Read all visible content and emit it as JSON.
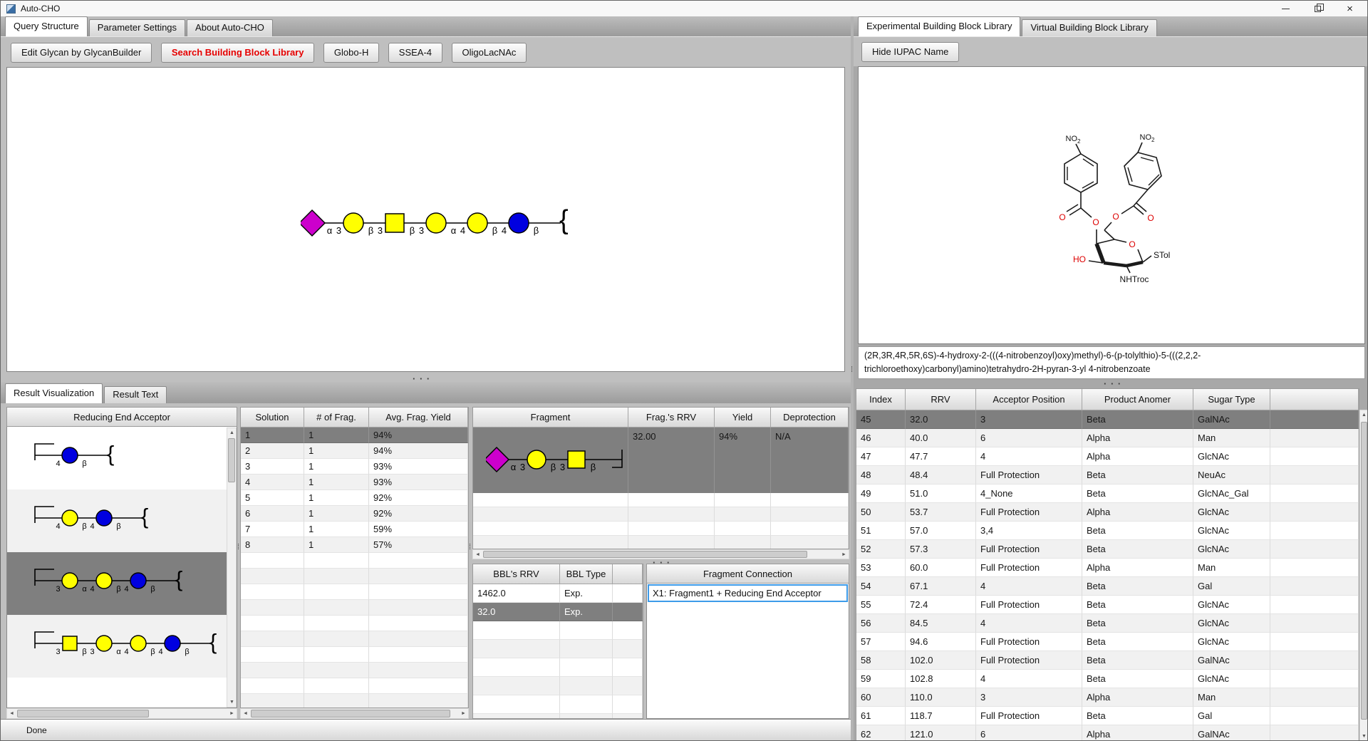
{
  "window": {
    "title": "Auto-CHO",
    "status": "Done"
  },
  "icons": {
    "up_arrow": "▲",
    "down_arrow": "▼",
    "left_arrow": "◄",
    "right_arrow": "►",
    "h_grip": "· · ·",
    "v_grip": "⁞",
    "close": "×"
  },
  "left_tabs": {
    "items": [
      "Query Structure",
      "Parameter Settings",
      "About Auto-CHO"
    ],
    "active": 0
  },
  "toolbar": {
    "buttons": [
      "Edit Glycan by GlycanBuilder",
      "Search Building Block Library",
      "Globo-H",
      "SSEA-4",
      "OligoLacNAc"
    ],
    "highlight_index": 1,
    "highlight_color": "#e60000"
  },
  "right_tabs": {
    "items": [
      "Experimental Building Block Library",
      "Virtual Building Block Library"
    ],
    "active": 0
  },
  "hide_iupac_button": "Hide IUPAC Name",
  "iupac_name": "(2R,3R,4R,5R,6S)-4-hydroxy-2-(((4-nitrobenzoyl)oxy)methyl)-6-(p-tolylthio)-5-(((2,2,2-trichloroethoxy)carbonyl)amino)tetrahydro-2H-pyran-3-yl 4-nitrobenzoate",
  "chem": {
    "no2": "NO",
    "no2_sub": "2",
    "o": "O",
    "ho": "HO",
    "stol": "STol",
    "nhtroc": "NHTroc"
  },
  "bottom_tabs": {
    "items": [
      "Result Visualization",
      "Result Text"
    ],
    "active": 0
  },
  "rea": {
    "header": "Reducing End Acceptor",
    "selected_index": 2,
    "items": [
      {
        "glycan": "rea1"
      },
      {
        "glycan": "rea2"
      },
      {
        "glycan": "rea3"
      },
      {
        "glycan": "rea4"
      },
      {
        "partial": true
      }
    ]
  },
  "solutions": {
    "headers": [
      "Solution",
      "# of Frag.",
      "Avg. Frag. Yield"
    ],
    "rows": [
      [
        "1",
        "1",
        "94%"
      ],
      [
        "2",
        "1",
        "94%"
      ],
      [
        "3",
        "1",
        "93%"
      ],
      [
        "4",
        "1",
        "93%"
      ],
      [
        "5",
        "1",
        "92%"
      ],
      [
        "6",
        "1",
        "92%"
      ],
      [
        "7",
        "1",
        "59%"
      ],
      [
        "8",
        "1",
        "57%"
      ]
    ],
    "selected_index": 0
  },
  "fragment_table": {
    "headers": [
      "Fragment",
      "Frag.'s RRV",
      "Yield",
      "Deprotection"
    ],
    "row": {
      "rrv": "32.00",
      "yield": "94%",
      "deprotection": "N/A"
    }
  },
  "bbl": {
    "headers": [
      "BBL's RRV",
      "BBL Type",
      ""
    ],
    "rows": [
      [
        "1462.0",
        "Exp."
      ],
      [
        "32.0",
        "Exp."
      ]
    ],
    "selected_index": 1
  },
  "fragment_connection": {
    "header": "Fragment Connection",
    "items": [
      "X1: Fragment1 + Reducing End Acceptor"
    ]
  },
  "right_table": {
    "headers": [
      "Index",
      "RRV",
      "Acceptor Position",
      "Product Anomer",
      "Sugar Type",
      ""
    ],
    "rows": [
      [
        "45",
        "32.0",
        "3",
        "Beta",
        "GalNAc"
      ],
      [
        "46",
        "40.0",
        "6",
        "Alpha",
        "Man"
      ],
      [
        "47",
        "47.7",
        "4",
        "Alpha",
        "GlcNAc"
      ],
      [
        "48",
        "48.4",
        "Full Protection",
        "Beta",
        "NeuAc"
      ],
      [
        "49",
        "51.0",
        "4_None",
        "Beta",
        "GlcNAc_Gal"
      ],
      [
        "50",
        "53.7",
        "Full Protection",
        "Alpha",
        "GlcNAc"
      ],
      [
        "51",
        "57.0",
        "3,4",
        "Beta",
        "GlcNAc"
      ],
      [
        "52",
        "57.3",
        "Full Protection",
        "Beta",
        "GlcNAc"
      ],
      [
        "53",
        "60.0",
        "Full Protection",
        "Alpha",
        "Man"
      ],
      [
        "54",
        "67.1",
        "4",
        "Beta",
        "Gal"
      ],
      [
        "55",
        "72.4",
        "Full Protection",
        "Beta",
        "GlcNAc"
      ],
      [
        "56",
        "84.5",
        "4",
        "Beta",
        "GlcNAc"
      ],
      [
        "57",
        "94.6",
        "Full Protection",
        "Beta",
        "GlcNAc"
      ],
      [
        "58",
        "102.0",
        "Full Protection",
        "Beta",
        "GalNAc"
      ],
      [
        "59",
        "102.8",
        "4",
        "Beta",
        "GlcNAc"
      ],
      [
        "60",
        "110.0",
        "3",
        "Alpha",
        "Man"
      ],
      [
        "61",
        "118.7",
        "Full Protection",
        "Beta",
        "Gal"
      ],
      [
        "62",
        "121.0",
        "6",
        "Alpha",
        "GalNAc"
      ]
    ],
    "selected_index": 0
  },
  "glycans": {
    "colors": {
      "gal_yellow": "#ffff00",
      "glc_blue": "#0000e0",
      "neu_magenta": "#cc00cc"
    },
    "query": {
      "unit": 28,
      "label": 13,
      "font": 13,
      "tokens": [
        [
          "u",
          "diamond",
          "#cc00cc"
        ],
        [
          "l",
          "α"
        ],
        [
          "l",
          "3"
        ],
        [
          "u",
          "circle",
          "#ffff00"
        ],
        [
          "l",
          "β"
        ],
        [
          "l",
          "3"
        ],
        [
          "u",
          "square",
          "#ffff00"
        ],
        [
          "l",
          "β"
        ],
        [
          "l",
          "3"
        ],
        [
          "u",
          "circle",
          "#ffff00"
        ],
        [
          "l",
          "α"
        ],
        [
          "l",
          "4"
        ],
        [
          "u",
          "circle",
          "#ffff00"
        ],
        [
          "l",
          "β"
        ],
        [
          "l",
          "4"
        ],
        [
          "u",
          "circle",
          "#0000e0"
        ],
        [
          "l",
          "β"
        ],
        [
          "g"
        ],
        [
          "b"
        ]
      ]
    },
    "fragment": {
      "unit": 26,
      "label": 13,
      "font": 13,
      "tokens": [
        [
          "u",
          "diamond",
          "#cc00cc"
        ],
        [
          "l",
          "α"
        ],
        [
          "l",
          "3"
        ],
        [
          "u",
          "circle",
          "#ffff00"
        ],
        [
          "l",
          "β"
        ],
        [
          "l",
          "3"
        ],
        [
          "u",
          "square",
          "#ffff00"
        ],
        [
          "l",
          "β"
        ],
        [
          "g"
        ],
        [
          "t"
        ]
      ]
    },
    "rea1": {
      "unit": 22,
      "label": 11,
      "font": 11,
      "tokens": [
        [
          "k"
        ],
        [
          "l",
          "4"
        ],
        [
          "u",
          "circle",
          "#0000e0"
        ],
        [
          "l",
          "β"
        ],
        [
          "g"
        ],
        [
          "b"
        ]
      ]
    },
    "rea2": {
      "unit": 22,
      "label": 11,
      "font": 11,
      "tokens": [
        [
          "k"
        ],
        [
          "l",
          "4"
        ],
        [
          "u",
          "circle",
          "#ffff00"
        ],
        [
          "l",
          "β"
        ],
        [
          "l",
          "4"
        ],
        [
          "u",
          "circle",
          "#0000e0"
        ],
        [
          "l",
          "β"
        ],
        [
          "g"
        ],
        [
          "b"
        ]
      ]
    },
    "rea3": {
      "unit": 22,
      "label": 11,
      "font": 11,
      "tokens": [
        [
          "k"
        ],
        [
          "l",
          "3"
        ],
        [
          "u",
          "circle",
          "#ffff00"
        ],
        [
          "l",
          "α"
        ],
        [
          "l",
          "4"
        ],
        [
          "u",
          "circle",
          "#ffff00"
        ],
        [
          "l",
          "β"
        ],
        [
          "l",
          "4"
        ],
        [
          "u",
          "circle",
          "#0000e0"
        ],
        [
          "l",
          "β"
        ],
        [
          "g"
        ],
        [
          "b"
        ]
      ]
    },
    "rea4": {
      "unit": 22,
      "label": 11,
      "font": 11,
      "tokens": [
        [
          "k"
        ],
        [
          "l",
          "3"
        ],
        [
          "u",
          "square",
          "#ffff00"
        ],
        [
          "l",
          "β"
        ],
        [
          "l",
          "3"
        ],
        [
          "u",
          "circle",
          "#ffff00"
        ],
        [
          "l",
          "α"
        ],
        [
          "l",
          "4"
        ],
        [
          "u",
          "circle",
          "#ffff00"
        ],
        [
          "l",
          "β"
        ],
        [
          "l",
          "4"
        ],
        [
          "u",
          "circle",
          "#0000e0"
        ],
        [
          "l",
          "β"
        ],
        [
          "g"
        ],
        [
          "b"
        ]
      ]
    }
  }
}
